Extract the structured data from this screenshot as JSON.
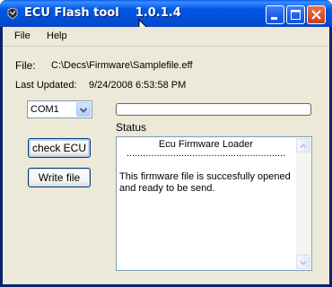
{
  "window": {
    "title": "ECU Flash tool",
    "version": "1.0.1.4"
  },
  "menu": {
    "items": [
      {
        "label": "File"
      },
      {
        "label": "Help"
      }
    ]
  },
  "file": {
    "label": "File:",
    "path": "C:\\Decs\\Firmware\\Samplefile.eff"
  },
  "last_updated": {
    "label": "Last Updated:",
    "value": "9/24/2008 6:53:58 PM"
  },
  "port": {
    "selected": "COM1"
  },
  "buttons": {
    "check_ecu": "check ECU",
    "write_file": "Write file"
  },
  "progress": {
    "value_percent": 0
  },
  "status": {
    "label": "Status",
    "header": "Ecu Firmware Loader",
    "separator": "..........................................................",
    "message": "This firmware file is succesfully opened and ready to be send."
  },
  "colors": {
    "titlebar": "#0058e6",
    "close_button": "#d6542c",
    "window_face": "#ece9d8",
    "progress_fill": "#2eb62e"
  },
  "icons": {
    "app": "flash-tool-icon",
    "minimize": "minimize-icon",
    "maximize": "maximize-icon",
    "close": "close-icon",
    "combo_arrow": "chevron-down-icon",
    "scroll_up": "scroll-up-icon",
    "scroll_down": "scroll-down-icon"
  }
}
